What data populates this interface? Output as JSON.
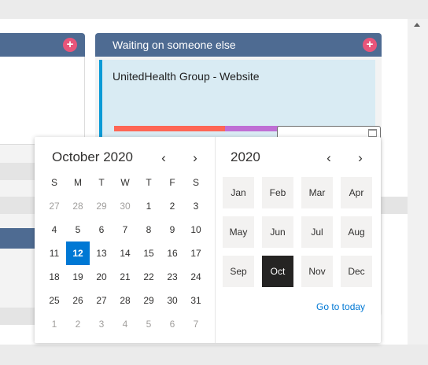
{
  "board": {
    "add_symbol": "+",
    "right_column": {
      "title": "Waiting on someone else",
      "card": {
        "title": "UnitedHealth Group - Website",
        "progress_fraction": 0.493,
        "progress_colors": {
          "done": "#ff6655",
          "remaining": "#bf6fd4"
        }
      }
    }
  },
  "calendar": {
    "month_title": "October 2020",
    "prev_month_symbol": "‹",
    "next_month_symbol": "›",
    "weekday_headers": [
      "S",
      "M",
      "T",
      "W",
      "T",
      "F",
      "S"
    ],
    "weeks": [
      [
        {
          "d": "27",
          "o": true
        },
        {
          "d": "28",
          "o": true
        },
        {
          "d": "29",
          "o": true
        },
        {
          "d": "30",
          "o": true
        },
        {
          "d": "1"
        },
        {
          "d": "2"
        },
        {
          "d": "3"
        }
      ],
      [
        {
          "d": "4"
        },
        {
          "d": "5"
        },
        {
          "d": "6"
        },
        {
          "d": "7"
        },
        {
          "d": "8"
        },
        {
          "d": "9"
        },
        {
          "d": "10"
        }
      ],
      [
        {
          "d": "11"
        },
        {
          "d": "12",
          "s": true
        },
        {
          "d": "13"
        },
        {
          "d": "14"
        },
        {
          "d": "15"
        },
        {
          "d": "16"
        },
        {
          "d": "17"
        }
      ],
      [
        {
          "d": "18"
        },
        {
          "d": "19"
        },
        {
          "d": "20"
        },
        {
          "d": "21"
        },
        {
          "d": "22"
        },
        {
          "d": "23"
        },
        {
          "d": "24"
        }
      ],
      [
        {
          "d": "25"
        },
        {
          "d": "26"
        },
        {
          "d": "27"
        },
        {
          "d": "28"
        },
        {
          "d": "29"
        },
        {
          "d": "30"
        },
        {
          "d": "31"
        }
      ],
      [
        {
          "d": "1",
          "o": true
        },
        {
          "d": "2",
          "o": true
        },
        {
          "d": "3",
          "o": true
        },
        {
          "d": "4",
          "o": true
        },
        {
          "d": "5",
          "o": true
        },
        {
          "d": "6",
          "o": true
        },
        {
          "d": "7",
          "o": true
        }
      ]
    ],
    "year_title": "2020",
    "prev_year_symbol": "‹",
    "next_year_symbol": "›",
    "months": [
      "Jan",
      "Feb",
      "Mar",
      "Apr",
      "May",
      "Jun",
      "Jul",
      "Aug",
      "Sep",
      "Oct",
      "Nov",
      "Dec"
    ],
    "selected_month": "Oct",
    "goto_today": "Go to today"
  },
  "colors": {
    "accent": "#0078d4",
    "header_blue": "#4e6b92",
    "add_pink": "#e8557a",
    "card_bg": "#d9ebf3",
    "card_stripe": "#0a9ad6"
  }
}
